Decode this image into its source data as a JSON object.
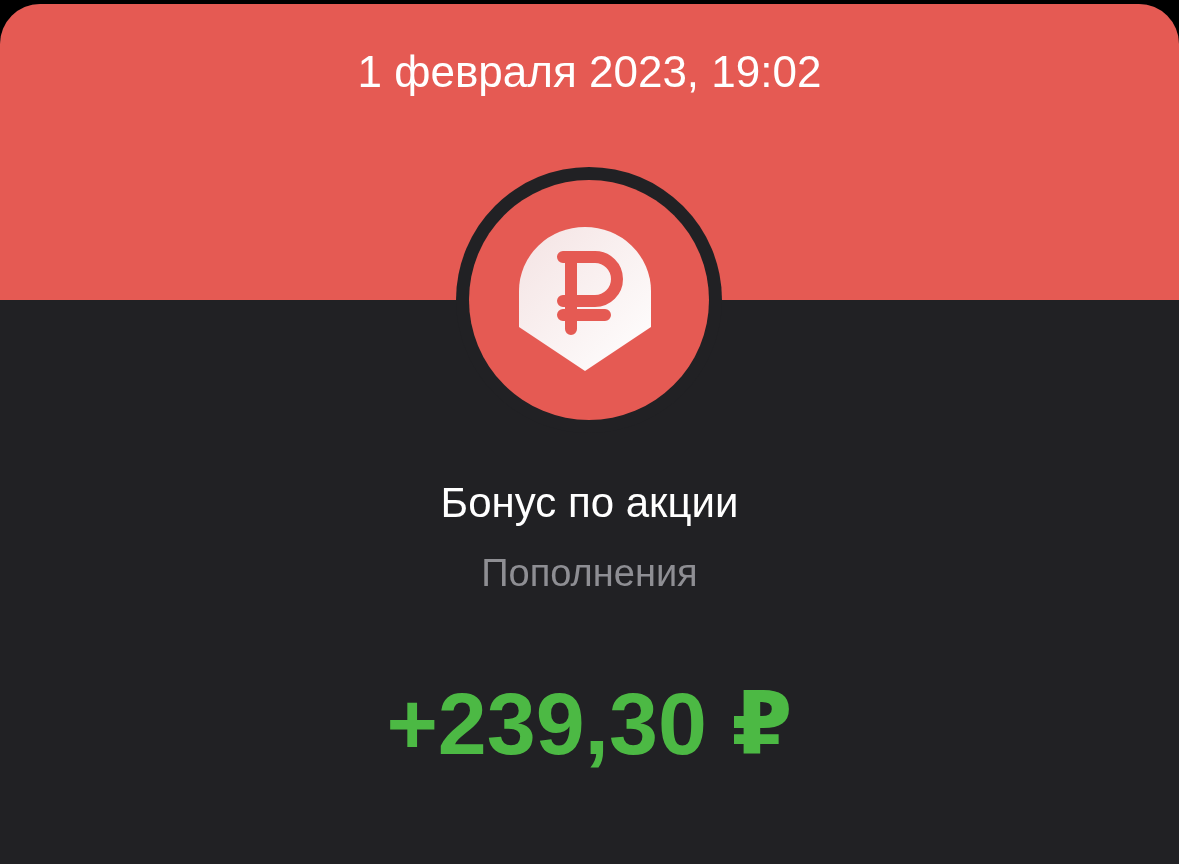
{
  "header": {
    "date": "1 февраля 2023, 19:02"
  },
  "operation": {
    "title": "Бонус по акции",
    "category": "Пополнения",
    "amount": "+239,30 ₽"
  }
}
